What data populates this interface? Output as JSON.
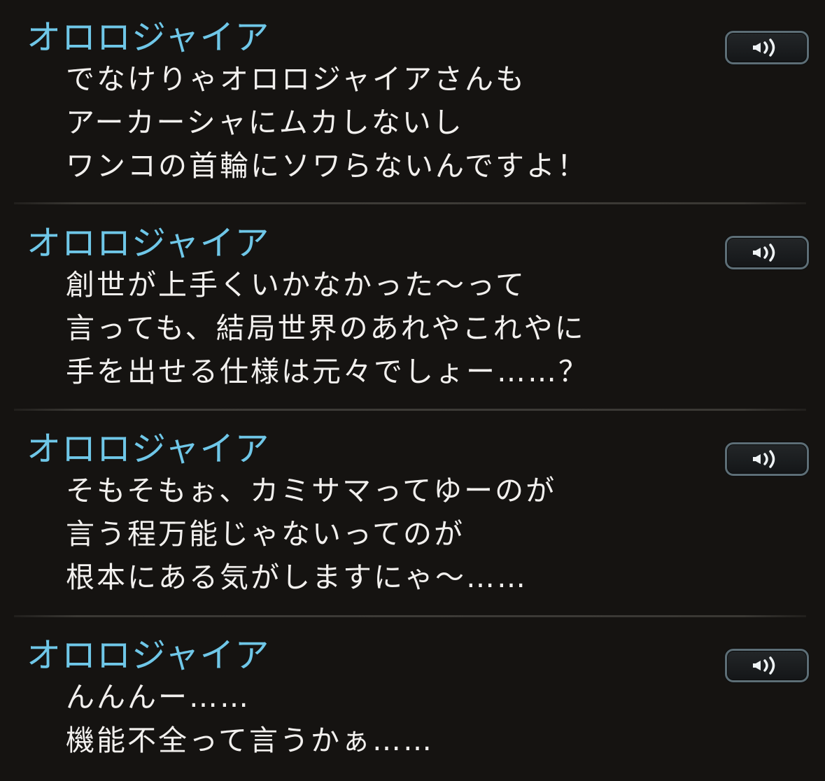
{
  "entries": [
    {
      "speaker": "オロロジャイア",
      "lines": [
        "でなけりゃオロロジャイアさんも",
        "アーカーシャにムカしないし",
        "ワンコの首輪にソワらないんですよ！"
      ],
      "voice_icon": "speaker-volume-icon"
    },
    {
      "speaker": "オロロジャイア",
      "lines": [
        "創世が上手くいかなかった〜って",
        "言っても、結局世界のあれやこれやに",
        "手を出せる仕様は元々でしょー……？"
      ],
      "voice_icon": "speaker-volume-icon"
    },
    {
      "speaker": "オロロジャイア",
      "lines": [
        "そもそもぉ、カミサマってゆーのが",
        "言う程万能じゃないってのが",
        "根本にある気がしますにゃ〜……"
      ],
      "voice_icon": "speaker-volume-icon"
    },
    {
      "speaker": "オロロジャイア",
      "lines": [
        "んんんー……",
        "機能不全って言うかぁ……"
      ],
      "voice_icon": "speaker-volume-icon"
    }
  ],
  "colors": {
    "background": "#151311",
    "speaker_name": "#6fc7e8",
    "dialogue_text": "#f2f0ee",
    "button_border": "#5d6e76"
  }
}
